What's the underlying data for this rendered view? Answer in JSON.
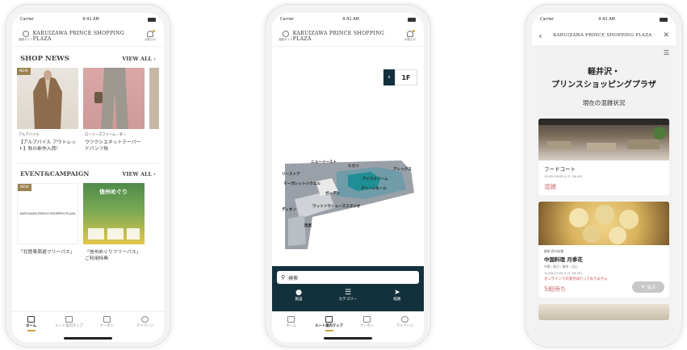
{
  "status": {
    "carrier": "Carrier",
    "time": "9:41 AM"
  },
  "brand": "KARUIZAWA PRINCE SHOPPING PLAZA",
  "header_icons": {
    "left_label": "施設ガイド",
    "right_label": "お知らせ"
  },
  "screen1": {
    "shop_news": {
      "title": "SHOP NEWS",
      "view_all": "VIEW ALL ›",
      "items": [
        {
          "badge": "NEW",
          "shop": "アルアバイル",
          "text": "【アルアバイル アウトレット】秋の新作入荷！"
        },
        {
          "shop": "ローリーズファーム・ダー",
          "text": "ウツクシエネットテーパードパンツ秋"
        }
      ]
    },
    "event": {
      "title": "EVENT&CAMPAIGN",
      "view_all": "VIEW ALL ›",
      "items": [
        {
          "badge": "NEW",
          "logo": "KARUIZAWA PRINCE SHOPPING PLAZA",
          "text": "「北陸東周遊フリーパス」"
        },
        {
          "poster_title": "信州めぐり",
          "text": "「信州めぐりフリーパス」ご利用特典"
        }
      ]
    }
  },
  "tabs": [
    {
      "label": "ホーム",
      "icon": "home-icon"
    },
    {
      "label": "ルート案内マップ",
      "icon": "map-icon"
    },
    {
      "label": "クーポン",
      "icon": "coupon-icon"
    },
    {
      "label": "マイページ",
      "icon": "user-icon"
    }
  ],
  "screen2": {
    "floor": "1F",
    "map_labels": [
      "ニューイースト",
      "リーストア",
      "マーガレットハウエル",
      "ディオン",
      "ガーデン",
      "アイスクリーム",
      "グリーンモール",
      "ワットソウシューズスタジオ",
      "西武",
      "ヒカリ",
      "アレックス"
    ],
    "search_placeholder": "検索",
    "actions": [
      {
        "label": "施設",
        "icon": "pin-icon"
      },
      {
        "label": "カテゴリー",
        "icon": "list-icon"
      },
      {
        "label": "経路",
        "icon": "navigate-icon"
      }
    ]
  },
  "screen3": {
    "mall_title_line1": "軽井沢・",
    "mall_title_line2": "プリンスショッピングプラザ",
    "subtitle": "現在の混雑状況",
    "cards": [
      {
        "name": "フードコート",
        "hours": "10:00-19:00 (L.O. 18:40)",
        "status": "混雑"
      },
      {
        "category": "飲茶 四川料理",
        "name": "中国料理 月季花",
        "detail": "中華 / 餃子 / 飲茶・点心",
        "hours": "11:00-21:00 (L.O. 20:30)",
        "notice": "オンラインでの受付は行っておりません",
        "status": "5組待ち",
        "button": "並ぶ"
      }
    ]
  }
}
